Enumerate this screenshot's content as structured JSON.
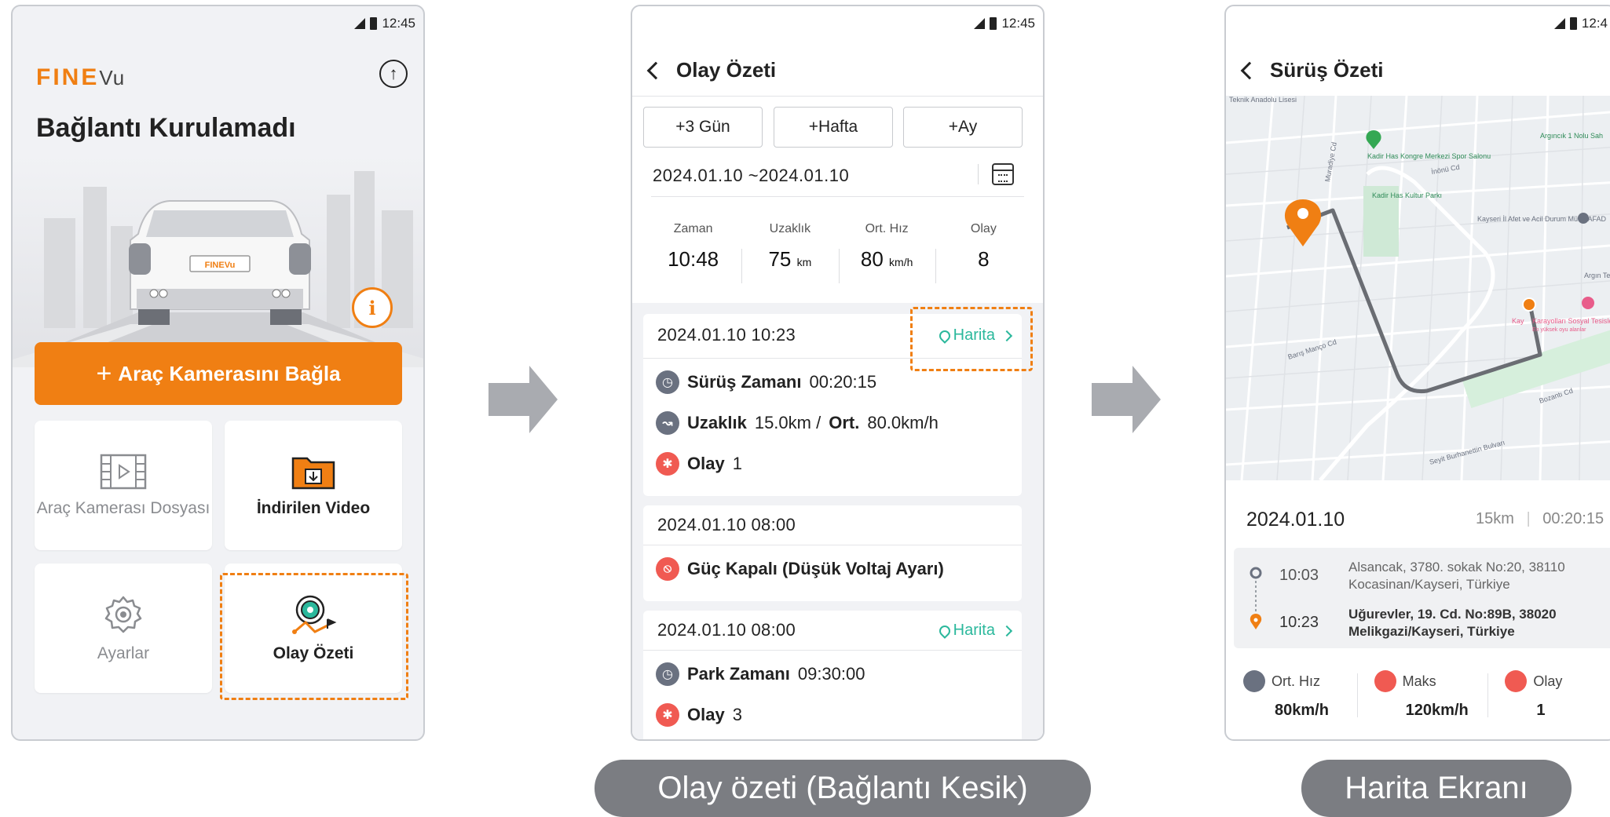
{
  "status_time": "12:45",
  "home": {
    "logo_main": "FINE",
    "logo_sub": "Vu",
    "title": "Bağlantı Kurulamadı",
    "plate_text": "FINEVu",
    "info_glyph": "i",
    "connect_label": "Araç Kamerasını Bağla",
    "tiles": [
      {
        "label": "Araç Kamerası Dosyası",
        "icon": "film-icon"
      },
      {
        "label": "İndirilen Video",
        "icon": "download-folder-icon"
      },
      {
        "label": "Ayarlar",
        "icon": "gear-icon"
      },
      {
        "label": "Olay Özeti",
        "icon": "route-camera-icon"
      }
    ]
  },
  "summary": {
    "title": "Olay Özeti",
    "range_buttons": [
      "+3 Gün",
      "+Hafta",
      "+Ay"
    ],
    "date_range": "2024.01.10 ~2024.01.10",
    "stats": [
      {
        "label": "Zaman",
        "value": "10:48",
        "unit": ""
      },
      {
        "label": "Uzaklık",
        "value": "75",
        "unit": "km"
      },
      {
        "label": "Ort. Hız",
        "value": "80",
        "unit": "km/h"
      },
      {
        "label": "Olay",
        "value": "8",
        "unit": ""
      }
    ],
    "map_link": "Harita",
    "cards": [
      {
        "date": "2024.01.10 10:23",
        "drive_label": "Sürüş Zamanı",
        "drive_value": "00:20:15",
        "dist_label": "Uzaklık",
        "dist_value": "15.0km /",
        "avg_label": "Ort.",
        "avg_value": "80.0km/h",
        "event_label": "Olay",
        "event_value": "1"
      },
      {
        "date": "2024.01.10 08:00",
        "power_label": "Güç Kapalı (Düşük Voltaj Ayarı)"
      },
      {
        "date": "2024.01.10 08:00",
        "park_label": "Park Zamanı",
        "park_value": "09:30:00",
        "event_label": "Olay",
        "event_value": "3"
      }
    ]
  },
  "map_screen": {
    "title": "Sürüş Özeti",
    "status_time_partial": "12:4",
    "labels": {
      "top_road": "Teknik Anadolu Lisesi",
      "poi_kongre": "Kadir Has Kongre Merkezi Spor Salonu",
      "poi_kultur": "Kadir Has Kultur Parkı",
      "poi_afad": "Kayseri İl Afet ve Acil Durum Müd - AFAD",
      "poi_top_right": "Argıncık 1 Nolu Sah",
      "poi_right": "Argın Teknik A",
      "poi_karayollari": "Karayolları Sosyal Tesisleri",
      "poi_karayollari_sub": "En yüksek oyu alanlar",
      "poi_kay": "Kay",
      "road_1": "Muradiye Cd",
      "road_2": "İnönü Cd",
      "road_3": "Barış Manço Cd",
      "road_4": "Bozantı Cd",
      "road_5": "Seyit Burhanettin Bulvarı"
    },
    "date": "2024.01.10",
    "distance": "15km",
    "duration": "00:20:15",
    "start_time": "10:03",
    "start_address": "Alsancak, 3780. sokak No:20, 38110 Kocasinan/Kayseri, Türkiye",
    "end_time": "10:23",
    "end_address": "Uğurevler, 19. Cd. No:89B, 38020 Melikgazi/Kayseri, Türkiye",
    "stats": [
      {
        "label": "Ort. Hız",
        "value": "80km/h"
      },
      {
        "label": "Maks",
        "value": "120km/h"
      },
      {
        "label": "Olay",
        "value": "1"
      }
    ]
  },
  "captions": {
    "summary": "Olay özeti (Bağlantı Kesik)",
    "map": "Harita Ekranı"
  },
  "colors": {
    "accent": "#f07f13",
    "teal": "#2bb89c",
    "event_red": "#f05a52",
    "caption_bg": "#7b7d82"
  }
}
